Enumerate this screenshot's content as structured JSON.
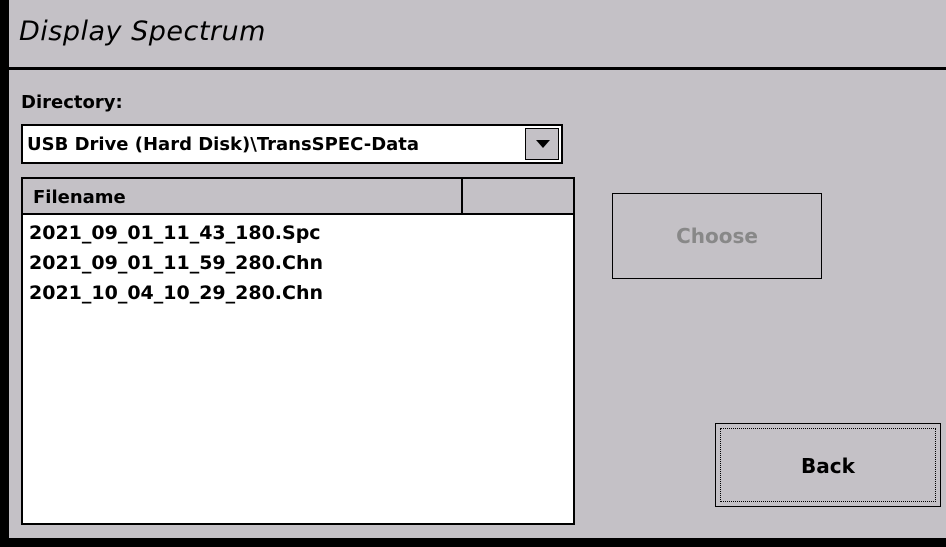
{
  "window": {
    "title": "Display Spectrum"
  },
  "directory": {
    "label": "Directory:",
    "selected": "USB Drive (Hard Disk)\\TransSPEC-Data"
  },
  "file_list": {
    "columns": [
      "Filename",
      ""
    ],
    "files": [
      "2021_09_01_11_43_180.Spc",
      "2021_09_01_11_59_280.Chn",
      "2021_10_04_10_29_280.Chn"
    ]
  },
  "buttons": {
    "choose_label": "Choose",
    "choose_enabled": false,
    "back_label": "Back"
  },
  "colors": {
    "window_bg": "#c4c1c6",
    "disabled_text": "#888888",
    "outer_frame": "#000000"
  }
}
